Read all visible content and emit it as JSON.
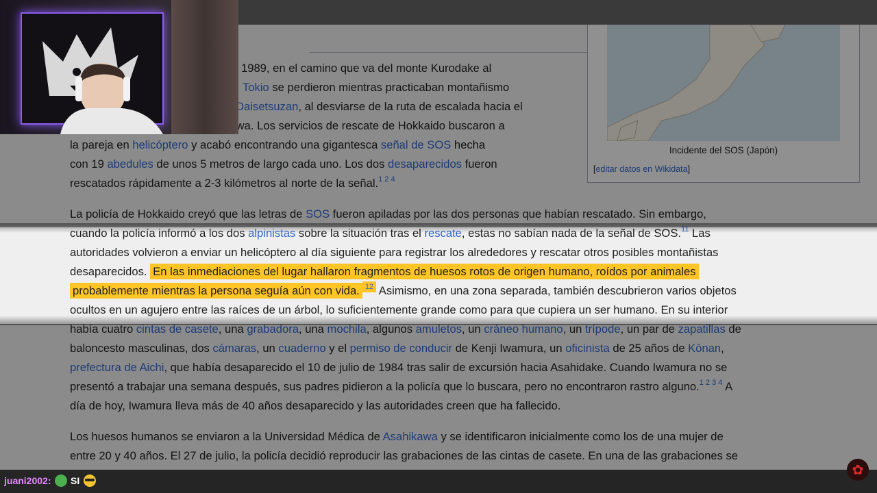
{
  "article": {
    "lines_a": [
      [
        {
          "t": "1989, en el camino que va del monte Kurodake al"
        }
      ],
      [
        {
          "t": "Tokio",
          "link": true
        },
        {
          "t": " se perdieron mientras practicaban montañismo"
        }
      ],
      [
        {
          "t": "Daisetsuzan",
          "link": true
        },
        {
          "t": ", al desviarse de la ruta de escalada hacia el"
        }
      ],
      [
        {
          "t": "ugawa. Los servicios de rescate de Hokkaido buscaron a"
        }
      ],
      [
        {
          "t": "la pareja en "
        },
        {
          "t": "helicóptero",
          "link": true
        },
        {
          "t": " y acabó encontrando una gigantesca "
        },
        {
          "t": "señal de SOS",
          "link": true
        },
        {
          "t": " hecha"
        }
      ],
      [
        {
          "t": "con 19 "
        },
        {
          "t": "abedules",
          "link": true
        },
        {
          "t": " de unos 5 metros de largo cada uno. Los dos "
        },
        {
          "t": "desaparecidos",
          "link": true
        },
        {
          "t": " fueron"
        }
      ],
      [
        {
          "t": "rescatados rápidamente a 2-3 kilómetros al norte de la señal."
        },
        {
          "t": "1 2 4",
          "sup": true
        }
      ]
    ],
    "para2": [
      [
        {
          "t": "La policía de Hokkaido creyó que las letras de "
        },
        {
          "t": "SOS",
          "link": true
        },
        {
          "t": " fueron apiladas por las dos personas que habían rescatado. Sin embargo,"
        }
      ],
      [
        {
          "t": "cuando la policía informó a los dos "
        },
        {
          "t": "alpinistas",
          "link": true
        },
        {
          "t": " sobre la situación tras el "
        },
        {
          "t": "rescate",
          "link": true
        },
        {
          "t": ", estas no sabían nada de la señal de SOS."
        },
        {
          "t": "11",
          "sup": true
        },
        {
          "t": " Las"
        }
      ],
      [
        {
          "t": "autoridades volvieron a enviar un helicóptero al día siguiente para registrar los alrededores y rescatar otros posibles montañistas"
        }
      ],
      [
        {
          "t": "desaparecidos. "
        },
        {
          "t": "En las inmediaciones del lugar hallaron fragmentos de huesos rotos de origen humano, roídos por animales",
          "hl": true
        }
      ],
      [
        {
          "t": "probablemente mientras la persona seguía aún con vida.",
          "hl": true
        },
        {
          "t": "12",
          "sup": true,
          "hl": true
        },
        {
          "t": " Asimismo, en una zona separada, también descubrieron varios objetos"
        }
      ],
      [
        {
          "t": "ocultos en un agujero entre las raíces de un árbol, lo suficientemente grande como para que cupiera un ser humano. En su interior"
        }
      ],
      [
        {
          "t": "había cuatro "
        },
        {
          "t": "cintas de casete",
          "link": true
        },
        {
          "t": ", una "
        },
        {
          "t": "grabadora",
          "link": true
        },
        {
          "t": ", una "
        },
        {
          "t": "mochila",
          "link": true
        },
        {
          "t": ", algunos "
        },
        {
          "t": "amuletos",
          "link": true
        },
        {
          "t": ", un "
        },
        {
          "t": "cráneo humano",
          "link": true
        },
        {
          "t": ", un "
        },
        {
          "t": "trípode",
          "link": true
        },
        {
          "t": ", un par de "
        },
        {
          "t": "zapatillas",
          "link": true
        },
        {
          "t": " de"
        }
      ],
      [
        {
          "t": "baloncesto masculinas, dos "
        },
        {
          "t": "cámaras",
          "link": true
        },
        {
          "t": ", un "
        },
        {
          "t": "cuaderno",
          "link": true
        },
        {
          "t": " y el "
        },
        {
          "t": "permiso de conducir",
          "link": true
        },
        {
          "t": " de Kenji Iwamura, un "
        },
        {
          "t": "oficinista",
          "link": true
        },
        {
          "t": " de 25 años de "
        },
        {
          "t": "Kōnan",
          "link": true
        },
        {
          "t": ","
        }
      ],
      [
        {
          "t": "prefectura de Aichi",
          "link": true
        },
        {
          "t": ", que había desaparecido el 10 de julio de 1984 tras salir de excursión hacia Asahidake. Cuando Iwamura no se"
        }
      ],
      [
        {
          "t": "presentó a trabajar una semana después, sus padres pidieron a la policía que lo buscara, pero no encontraron rastro alguno."
        },
        {
          "t": "1 2 3 4",
          "sup": true
        },
        {
          "t": " A"
        }
      ],
      [
        {
          "t": "día de hoy, Iwamura lleva más de 40 años desaparecido y las autoridades creen que ha fallecido."
        }
      ]
    ],
    "para3": [
      [
        {
          "t": "Los huesos humanos se enviaron a la Universidad Médica de "
        },
        {
          "t": "Asahikawa",
          "link": true
        },
        {
          "t": " y se identificaron inicialmente como los de una mujer de"
        }
      ],
      [
        {
          "t": "entre 20 y 40 años. El 27 de julio, la policía decidió reproducir las grabaciones de las cintas de casete. En una de las grabaciones se"
        }
      ]
    ]
  },
  "infobox": {
    "caption": "Incidente del SOS (Japón)",
    "wikidata_label": "editar datos en Wikidata"
  },
  "chat": {
    "username": "juani2002:",
    "message": "SI",
    "emote1": "frog-emote",
    "emote2": "sunglasses-emote"
  },
  "colors": {
    "highlight": "#ffc526",
    "link": "#3366cc",
    "username": "#e58bff"
  }
}
